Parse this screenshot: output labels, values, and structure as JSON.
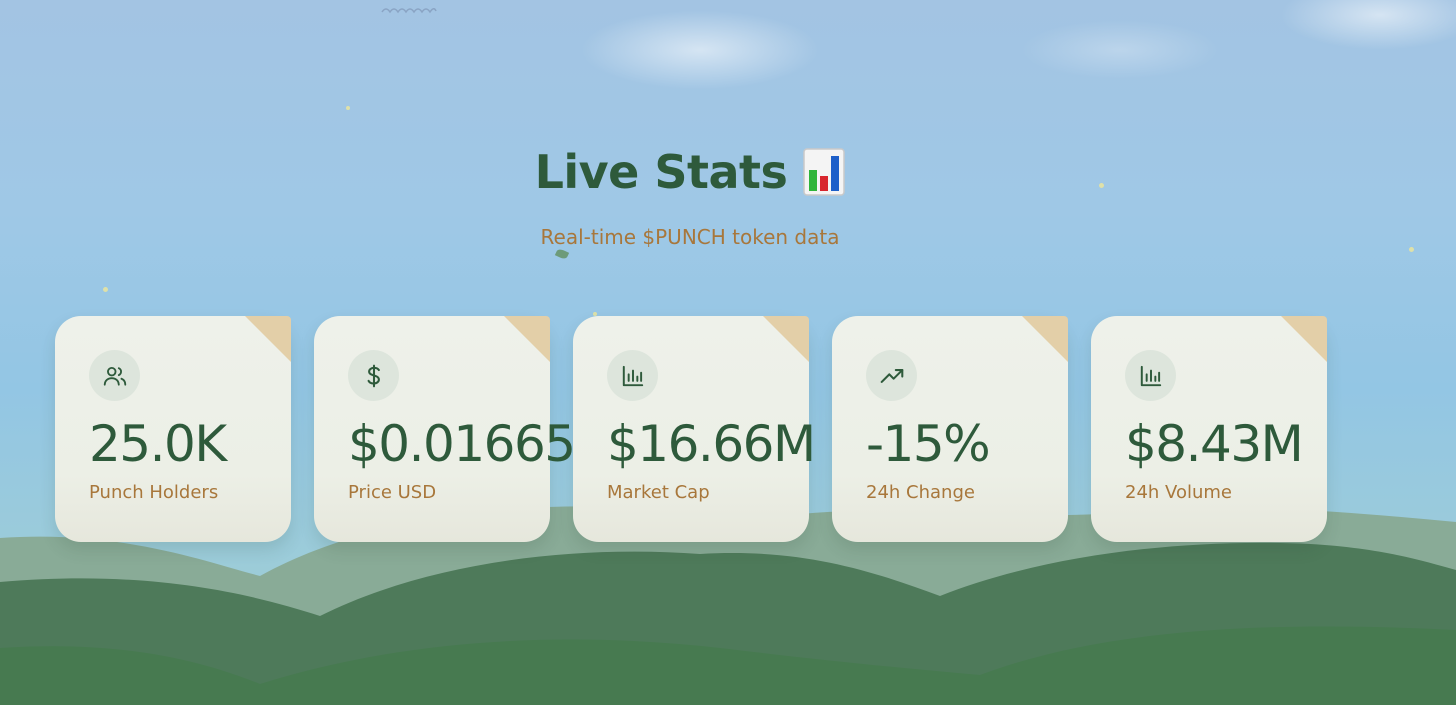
{
  "header": {
    "title": "Live Stats",
    "title_icon": "bar-chart-emoji-icon",
    "subtitle": "Real-time $PUNCH token data"
  },
  "stats": [
    {
      "icon": "users-icon",
      "value": "25.0K",
      "label": "Punch Holders"
    },
    {
      "icon": "dollar-icon",
      "value": "$0.01665",
      "label": "Price USD"
    },
    {
      "icon": "bar-chart-icon",
      "value": "$16.66M",
      "label": "Market Cap"
    },
    {
      "icon": "trending-up-icon",
      "value": "-15%",
      "label": "24h Change"
    },
    {
      "icon": "bar-chart-icon",
      "value": "$8.43M",
      "label": "24h Volume"
    }
  ],
  "colors": {
    "title": "#2e5a3b",
    "accent": "#a8773b",
    "card": "#eef1ea",
    "card_corner": "#e3cfa8",
    "hill_light": "#89ab97",
    "hill_dark": "#4e7a5a"
  }
}
